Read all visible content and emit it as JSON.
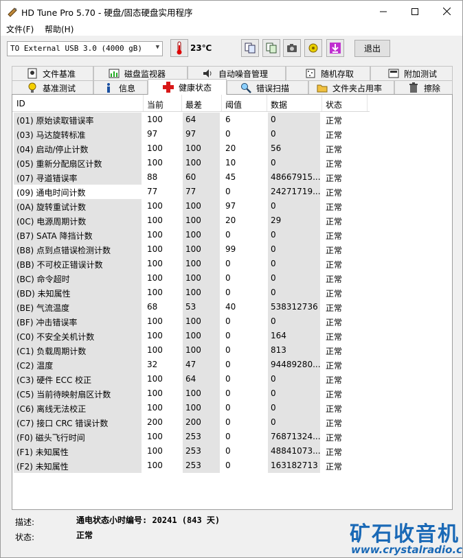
{
  "window": {
    "title": "HD Tune Pro 5.70 - 硬盘/固态硬盘实用程序"
  },
  "menu": {
    "file": "文件(F)",
    "help": "帮助(H)"
  },
  "toolbar": {
    "drive": "TO External USB 3.0 (4000 gB)",
    "temperature": "23℃",
    "exit": "退出"
  },
  "tabs_row1": [
    "文件基准",
    "磁盘监视器",
    "自动噪音管理",
    "随机存取",
    "附加测试"
  ],
  "tabs_row2": [
    "基准测试",
    "信息",
    "健康状态",
    "错误扫描",
    "文件夹占用率",
    "擦除"
  ],
  "active_tab": "健康状态",
  "table": {
    "headers": [
      "ID",
      "当前",
      "最差",
      "阈值",
      "数据",
      "状态"
    ],
    "rows": [
      [
        "(01) 原始读取错误率",
        "100",
        "64",
        "6",
        "0",
        "正常"
      ],
      [
        "(03) 马达旋转标准",
        "97",
        "97",
        "0",
        "0",
        "正常"
      ],
      [
        "(04) 启动/停止计数",
        "100",
        "100",
        "20",
        "56",
        "正常"
      ],
      [
        "(05) 重新分配扇区计数",
        "100",
        "100",
        "10",
        "0",
        "正常"
      ],
      [
        "(07) 寻道错误率",
        "88",
        "60",
        "45",
        "48667915...",
        "正常"
      ],
      [
        "(09) 通电时间计数",
        "77",
        "77",
        "0",
        "24271719...",
        "正常"
      ],
      [
        "(0A) 旋转重试计数",
        "100",
        "100",
        "97",
        "0",
        "正常"
      ],
      [
        "(0C) 电源周期计数",
        "100",
        "100",
        "20",
        "29",
        "正常"
      ],
      [
        "(B7) SATA 降挡计数",
        "100",
        "100",
        "0",
        "0",
        "正常"
      ],
      [
        "(B8) 点到点错误检测计数",
        "100",
        "100",
        "99",
        "0",
        "正常"
      ],
      [
        "(BB) 不可校正错误计数",
        "100",
        "100",
        "0",
        "0",
        "正常"
      ],
      [
        "(BC) 命令超时",
        "100",
        "100",
        "0",
        "0",
        "正常"
      ],
      [
        "(BD) 未知属性",
        "100",
        "100",
        "0",
        "0",
        "正常"
      ],
      [
        "(BE) 气流温度",
        "68",
        "53",
        "40",
        "538312736",
        "正常"
      ],
      [
        "(BF) 冲击错误率",
        "100",
        "100",
        "0",
        "0",
        "正常"
      ],
      [
        "(C0) 不安全关机计数",
        "100",
        "100",
        "0",
        "164",
        "正常"
      ],
      [
        "(C1) 负载周期计数",
        "100",
        "100",
        "0",
        "813",
        "正常"
      ],
      [
        "(C2) 温度",
        "32",
        "47",
        "0",
        "94489280...",
        "正常"
      ],
      [
        "(C3) 硬件 ECC 校正",
        "100",
        "64",
        "0",
        "0",
        "正常"
      ],
      [
        "(C5) 当前待映射扇区计数",
        "100",
        "100",
        "0",
        "0",
        "正常"
      ],
      [
        "(C6) 离线无法校正",
        "100",
        "100",
        "0",
        "0",
        "正常"
      ],
      [
        "(C7) 接口 CRC 错误计数",
        "200",
        "200",
        "0",
        "0",
        "正常"
      ],
      [
        "(F0) 磁头飞行时间",
        "100",
        "253",
        "0",
        "76871324...",
        "正常"
      ],
      [
        "(F1) 未知属性",
        "100",
        "253",
        "0",
        "48841073...",
        "正常"
      ],
      [
        "(F2) 未知属性",
        "100",
        "253",
        "0",
        "163182713",
        "正常"
      ]
    ]
  },
  "footer": {
    "desc_label": "描述:",
    "desc_value": "通电状态小时编号: 20241 (843 天)",
    "status_label": "状态:",
    "status_value": "正常"
  },
  "watermark": {
    "line1": "矿石收音机",
    "line2": "www.crystalradio.cn"
  },
  "colors": {
    "accent": "#1a69b6",
    "cell_grey": "#e3e3e3"
  }
}
